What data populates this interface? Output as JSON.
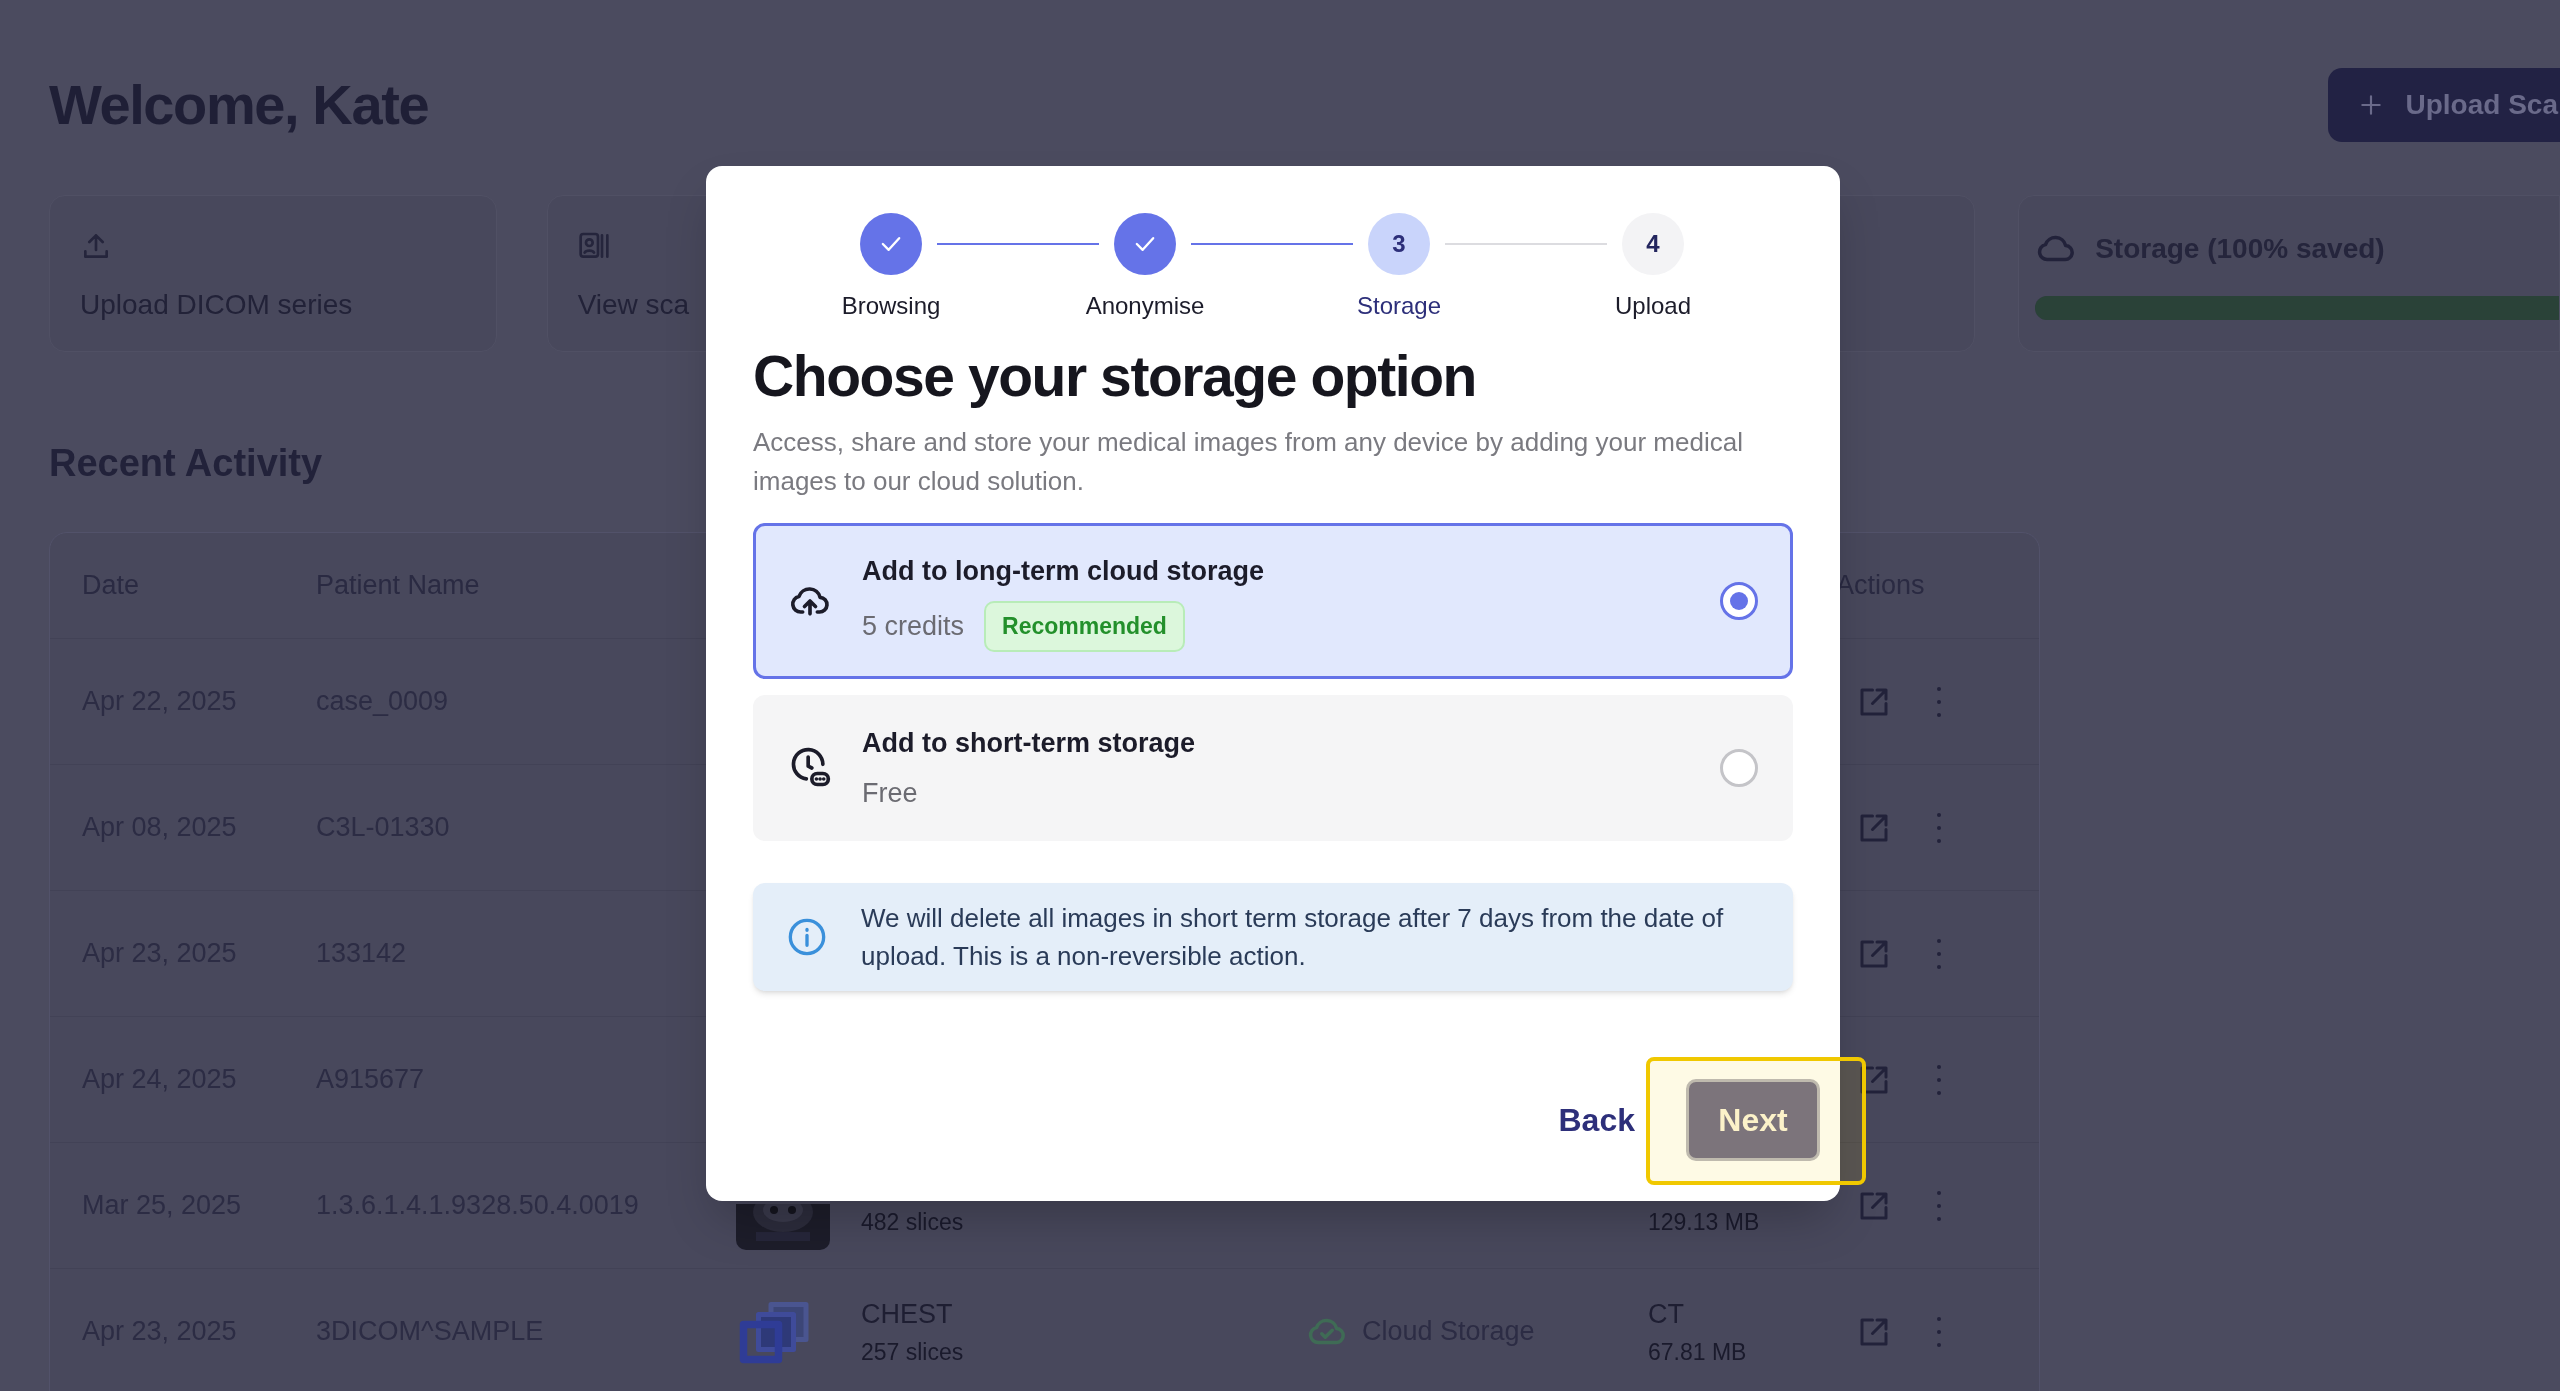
{
  "page": {
    "title": "Welcome, Kate",
    "upload_button": "Upload Sca",
    "cards": [
      {
        "kind": "upload",
        "label": "Upload DICOM series"
      },
      {
        "kind": "scans",
        "label": "View sca"
      },
      {
        "kind": "hidden"
      }
    ],
    "storage": {
      "label": "Storage (100% saved)",
      "level": 1
    },
    "recent_title": "Recent Activity",
    "table": {
      "columns": [
        "Date",
        "Patient Name",
        "Actions"
      ],
      "rows": [
        {
          "date": "Apr 22, 2025",
          "patient": "case_0009"
        },
        {
          "date": "Apr 08, 2025",
          "patient": "C3L-01330"
        },
        {
          "date": "Apr 23, 2025",
          "patient": "133142"
        },
        {
          "date": "Apr 24, 2025",
          "patient": "A915677"
        },
        {
          "date": "Mar 25, 2025",
          "patient": "1.3.6.1.4.1.9328.50.4.0019",
          "slices": "482 slices",
          "size": "129.13 MB"
        },
        {
          "date": "Apr 23, 2025",
          "patient": "3DICOM^SAMPLE",
          "thumb": {
            "kind": "stack"
          },
          "series": "CHEST",
          "slices": "257 slices",
          "storage": "Cloud Storage",
          "modality": "CT",
          "size": "67.81 MB"
        }
      ]
    }
  },
  "dialog": {
    "steps": [
      {
        "label": "Browsing",
        "done": true,
        "selected": false
      },
      {
        "label": "Anonymise",
        "done": true,
        "selected": false
      },
      {
        "label": "Storage",
        "done": false,
        "selected": true,
        "number": "3"
      },
      {
        "label": "Upload",
        "done": false,
        "selected": false,
        "number": "4"
      }
    ],
    "title": "Choose your storage option",
    "description": "Access, share and store your medical images from any device by adding your medical images to our cloud solution.",
    "options": [
      {
        "kind": "cloud",
        "title": "Add to long-term cloud storage",
        "detail": "5 credits",
        "badge": "Recommended",
        "selected": true
      },
      {
        "kind": "clock",
        "title": "Add to short-term storage",
        "detail": "Free",
        "selected": false
      }
    ],
    "notice": "We will delete all images in short term storage after 7 days from the date of upload. This is a non-reversible action.",
    "back": "Back",
    "next": "Next",
    "next_highlighted": true
  }
}
